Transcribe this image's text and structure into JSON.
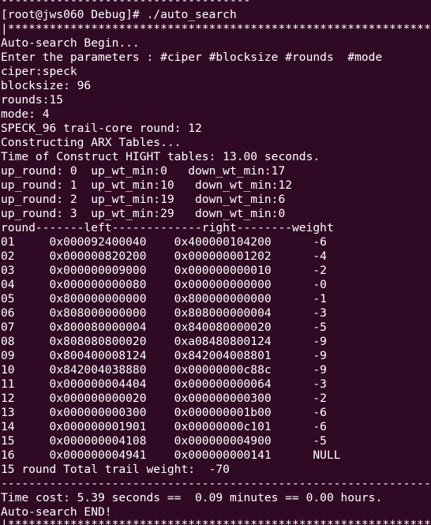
{
  "terminal": {
    "lines": [
      "------------------------------------",
      "[root@jws060 Debug]# ./auto_search",
      "|*************************************************************",
      "Auto-search Begin...",
      "Enter the parameters : #ciper #blocksize #rounds  #mode",
      "ciper:speck",
      "blocksize: 96",
      "rounds:15",
      "mode: 4",
      "SPECK_96 trail-core round: 12",
      "Constructing ARX Tables...",
      "Time of Construct HIGHT tables: 13.00 seconds.",
      "up_round: 0  up_wt_min:0   down_wt_min:17",
      "up_round: 1  up_wt_min:10   down_wt_min:12",
      "up_round: 2  up_wt_min:19   down_wt_min:6",
      "up_round: 3  up_wt_min:29   down_wt_min:0",
      "round-------left-------------right--------weight",
      "01     0x000092400040    0x400000104200      -6",
      "02     0x000000820200    0x000000001202      -4",
      "03     0x000000009000    0x000000000010      -2",
      "04     0x000000000080    0x000000000000      -0",
      "05     0x800000000000    0x800000000000      -1",
      "06     0x808000000000    0x808000000004      -3",
      "07     0x800080000004    0x840080000020      -5",
      "08     0x808080800020    0xa08480800124      -9",
      "09     0x800400008124    0x842004008801      -9",
      "10     0x842004038880    0x00000000c88c      -9",
      "11     0x000000004404    0x000000000064      -3",
      "12     0x000000000020    0x000000000300      -2",
      "13     0x000000000300    0x000000001b00      -6",
      "14     0x000000001901    0x00000000c101      -6",
      "15     0x000000004108    0x000000004900      -5",
      "16     0x000000004941    0x000000000141      NULL",
      "15 round Total trail weight:  -70",
      "------------------------------------------------------------------",
      "Time cost: 5.39 seconds ==  0.09 minutes == 0.00 hours.",
      "Auto-search END!",
      "|*************************************************************"
    ]
  }
}
